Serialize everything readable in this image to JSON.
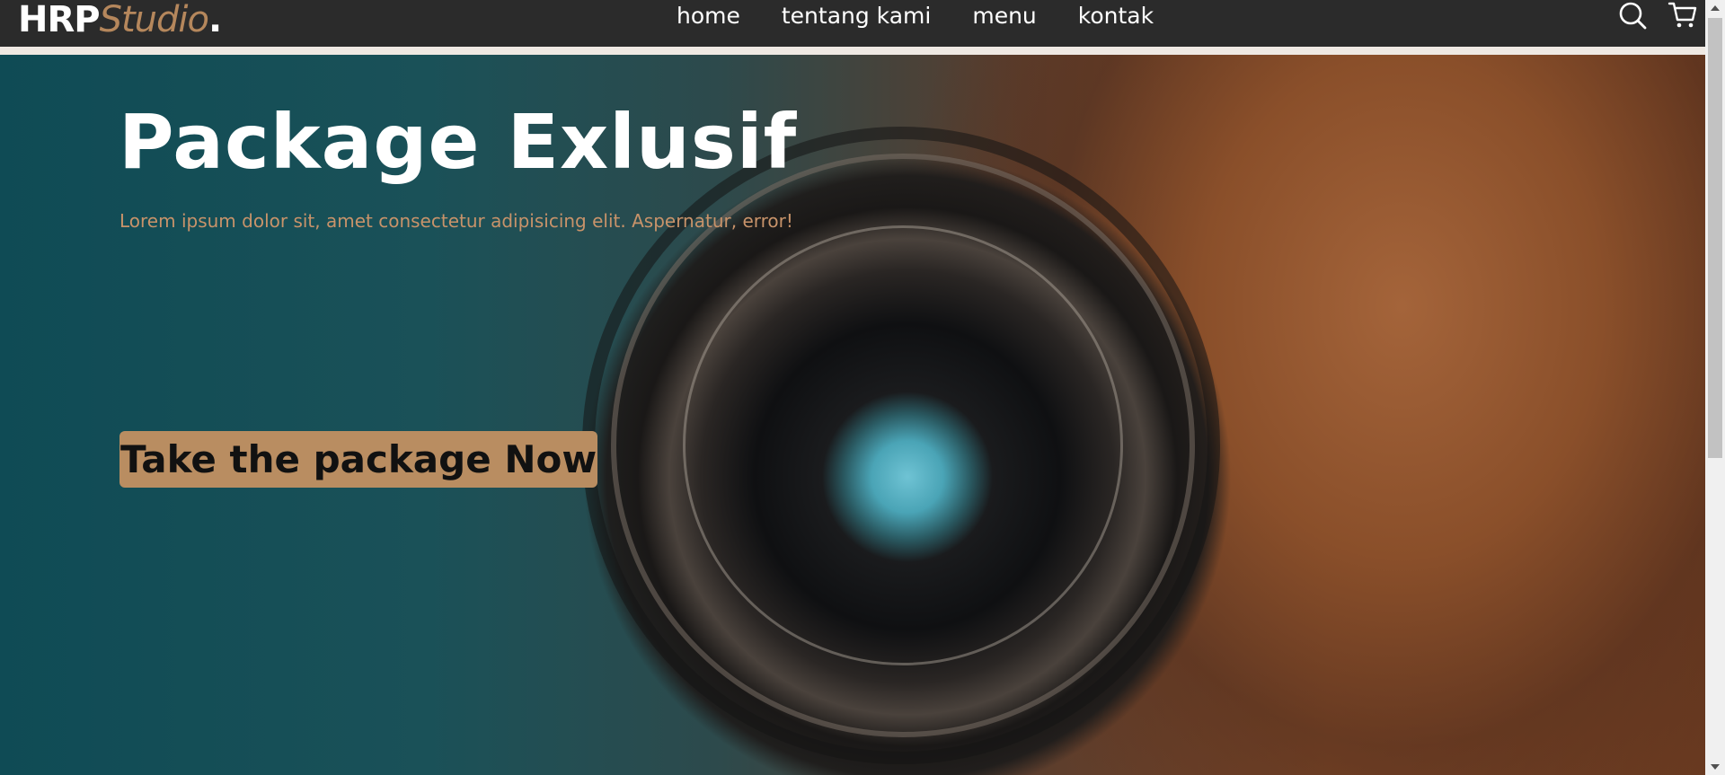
{
  "navbar": {
    "logo": {
      "hrp": "HRP",
      "studio": "Studio",
      "dot": "."
    },
    "links": [
      {
        "label": "home"
      },
      {
        "label": "tentang kami"
      },
      {
        "label": "menu"
      },
      {
        "label": "kontak"
      }
    ],
    "icons": [
      "search-icon",
      "cart-icon"
    ]
  },
  "hero": {
    "title": "Package Exlusif",
    "description": "Lorem ipsum dolor sit, amet consectetur adipisicing elit. Aspernatur, error!",
    "cta_label": "Take the package Now"
  },
  "colors": {
    "navbar_bg": "#2b2b2b",
    "accent": "#b98d61",
    "description_text": "#c8936a"
  }
}
